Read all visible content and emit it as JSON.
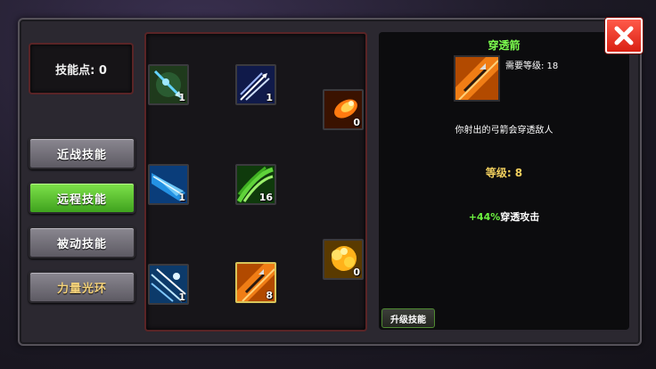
{
  "points": {
    "label": "技能点: 0"
  },
  "categories": [
    {
      "label": "近战技能",
      "active": false
    },
    {
      "label": "远程技能",
      "active": true
    },
    {
      "label": "被动技能",
      "active": false
    },
    {
      "label": "力量光环",
      "active": false
    }
  ],
  "skills": [
    {
      "icon": "blue-arrow-icon",
      "level": "1"
    },
    {
      "icon": "multi-arrow-icon",
      "level": "1"
    },
    {
      "icon": "fire-arrow-icon",
      "level": "0"
    },
    {
      "icon": "ice-arrow-icon",
      "level": "1"
    },
    {
      "icon": "poison-arrow-icon",
      "level": "16"
    },
    {
      "icon": "explosive-arrow-icon",
      "level": "0"
    },
    {
      "icon": "arrow-rain-icon",
      "level": "1"
    },
    {
      "icon": "piercing-arrow-icon",
      "level": "8",
      "selected": true
    }
  ],
  "detail": {
    "name": "穿透箭",
    "requirement": "需要等级: 18",
    "description": "你射出的弓箭会穿透敌人",
    "level": "等级: 8",
    "bonus_value": "+44%",
    "bonus_text": "穿透攻击",
    "icon": "piercing-arrow-icon"
  },
  "upgrade_label": "升级技能",
  "colors": {
    "accent_green": "#6cf13f",
    "gold": "#f2d05e",
    "close_red": "#e8301f"
  }
}
